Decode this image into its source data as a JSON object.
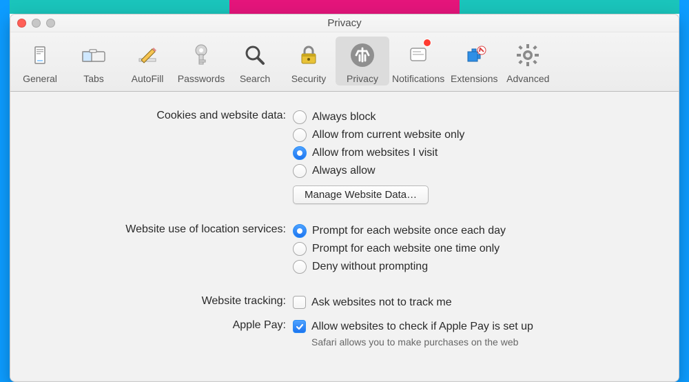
{
  "window": {
    "title": "Privacy"
  },
  "toolbar": {
    "items": [
      {
        "id": "general",
        "label": "General"
      },
      {
        "id": "tabs",
        "label": "Tabs"
      },
      {
        "id": "autofill",
        "label": "AutoFill"
      },
      {
        "id": "passwords",
        "label": "Passwords"
      },
      {
        "id": "search",
        "label": "Search"
      },
      {
        "id": "security",
        "label": "Security"
      },
      {
        "id": "privacy",
        "label": "Privacy"
      },
      {
        "id": "notifications",
        "label": "Notifications"
      },
      {
        "id": "extensions",
        "label": "Extensions"
      },
      {
        "id": "advanced",
        "label": "Advanced"
      }
    ],
    "active": "privacy",
    "notifications_badge": true
  },
  "sections": {
    "cookies": {
      "label": "Cookies and website data:",
      "options": [
        {
          "label": "Always block"
        },
        {
          "label": "Allow from current website only"
        },
        {
          "label": "Allow from websites I visit"
        },
        {
          "label": "Always allow"
        }
      ],
      "selected_index": 2,
      "manage_button": "Manage Website Data…"
    },
    "location": {
      "label": "Website use of location services:",
      "options": [
        {
          "label": "Prompt for each website once each day"
        },
        {
          "label": "Prompt for each website one time only"
        },
        {
          "label": "Deny without prompting"
        }
      ],
      "selected_index": 0
    },
    "tracking": {
      "label": "Website tracking:",
      "checkbox_label": "Ask websites not to track me",
      "checked": false
    },
    "applepay": {
      "label": "Apple Pay:",
      "checkbox_label": "Allow websites to check if Apple Pay is set up",
      "checked": true,
      "hint": "Safari allows you to make purchases on the web"
    }
  }
}
